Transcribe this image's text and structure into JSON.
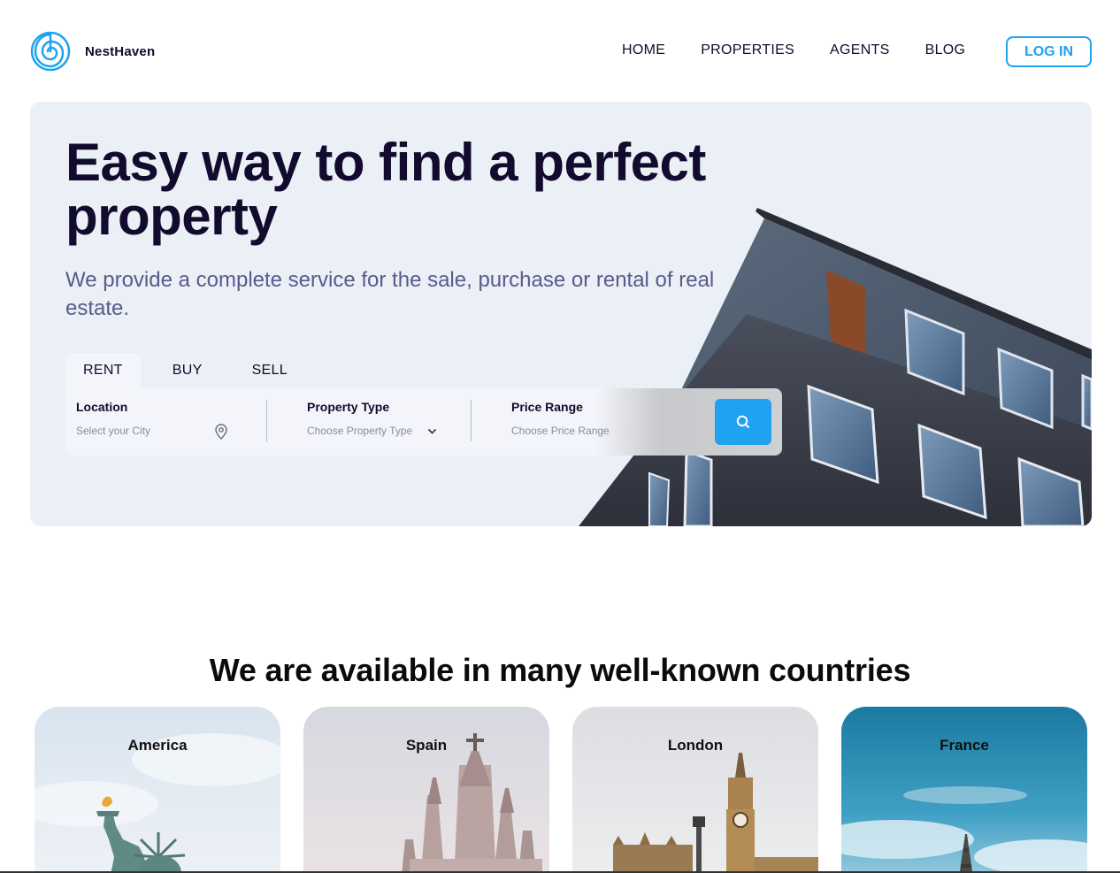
{
  "brand": {
    "name": "NestHaven",
    "logo_icon": "spiral-logo-icon",
    "accent_color": "#1ea2f1"
  },
  "nav": {
    "items": [
      {
        "label": "HOME"
      },
      {
        "label": "PROPERTIES"
      },
      {
        "label": "AGENTS"
      },
      {
        "label": "BLOG"
      }
    ],
    "login_label": "LOG IN"
  },
  "hero": {
    "title": "Easy way to find a perfect property",
    "subtitle": "We provide a complete service for the sale, purchase or rental of real estate.",
    "tabs": [
      {
        "label": "RENT",
        "active": true
      },
      {
        "label": "BUY",
        "active": false
      },
      {
        "label": "SELL",
        "active": false
      }
    ],
    "search": {
      "location": {
        "label": "Location",
        "placeholder": "Select your City",
        "icon": "map-pin-icon"
      },
      "property_type": {
        "label": "Property Type",
        "placeholder": "Choose Property Type",
        "icon": "chevron-down-icon"
      },
      "price_range": {
        "label": "Price Range",
        "placeholder": "Choose Price Range"
      },
      "button_icon": "search-icon"
    }
  },
  "countries": {
    "title": "We are available in many well-known countries",
    "items": [
      {
        "name": "America"
      },
      {
        "name": "Spain"
      },
      {
        "name": "London"
      },
      {
        "name": "France"
      }
    ]
  }
}
